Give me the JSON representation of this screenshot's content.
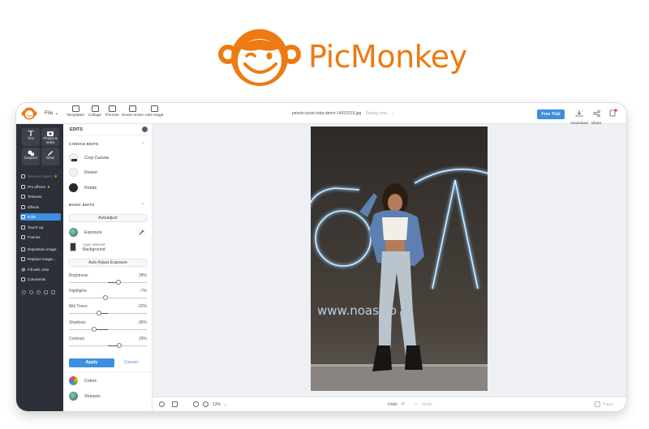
{
  "logo": {
    "text": "PicMonkey",
    "brand_color": "#ed7a13"
  },
  "topbar": {
    "file_menu": "File ⌄",
    "tools": [
      "Templates",
      "Collage",
      "Themes",
      "Smart resize",
      "Add image"
    ],
    "filename": "pexels-ozzie-tuba-demir-14931519.jpg",
    "saving": "Saving now...   ⌄",
    "free_trial": "Free Trial",
    "download": "Download",
    "share": "Share"
  },
  "sidebar": {
    "tiles": [
      "Text",
      "Photos & Video",
      "Graphics",
      "Draw"
    ],
    "items": [
      {
        "label": "Remove object",
        "dim": true,
        "crown": true
      },
      {
        "label": "Pro effects",
        "crown": true
      },
      {
        "label": "Textures"
      },
      {
        "label": "Effects"
      },
      {
        "label": "Edits",
        "active": true
      },
      {
        "label": "Touch Up"
      },
      {
        "label": "Frames"
      },
      {
        "label": "Reposition image"
      },
      {
        "label": "Replace image..."
      },
      {
        "label": "Fill with color"
      },
      {
        "label": "Comments"
      }
    ],
    "accent": "#3d8fe0"
  },
  "panel": {
    "title": "EDITS",
    "canvas_section": "CANVAS EDITS",
    "canvas_items": [
      "Crop Canvas",
      "Resize",
      "Rotate"
    ],
    "basic_section": "BASIC EDITS",
    "autoadjust": "Autoadjust",
    "exposure": "Exposure",
    "layer_selected": "Layer selected",
    "layer_name": "Background",
    "auto_adjust_exposure": "Auto Adjust Exposure",
    "sliders": [
      {
        "label": "Brightness",
        "value": "28%",
        "level": 0.64
      },
      {
        "label": "Highlights",
        "value": "-7%",
        "level": 0.465
      },
      {
        "label": "Mid Tones",
        "value": "-22%",
        "level": 0.39
      },
      {
        "label": "Shadows",
        "value": "-36%",
        "level": 0.32
      },
      {
        "label": "Contrast",
        "value": "29%",
        "level": 0.645
      }
    ],
    "apply": "Apply",
    "cancel": "Cancel",
    "more_items": [
      "Colors",
      "Sharpen"
    ]
  },
  "photo": {
    "wall_text": "www.noas.co"
  },
  "bottombar": {
    "zoom": "13%",
    "undo": "Undo",
    "redo": "Redo",
    "paper": "Paper"
  }
}
